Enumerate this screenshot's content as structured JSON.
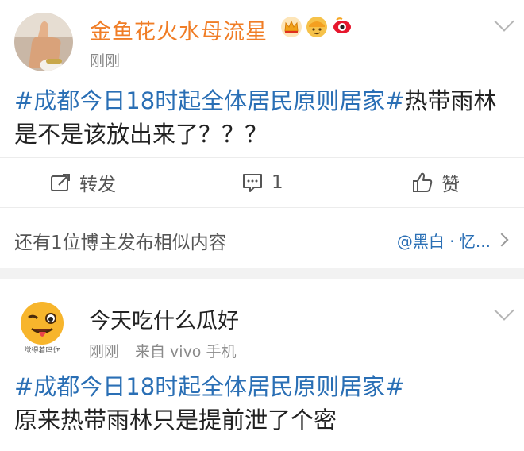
{
  "post1": {
    "username": "金鱼花火水母流星",
    "timestamp": "刚刚",
    "hashtag": "#成都今日18时起全体居民原则居家#",
    "body": "热带雨林是不是该放出来了？？？",
    "actions": {
      "repost_label": "转发",
      "comment_count": "1",
      "like_label": "赞"
    },
    "similar": {
      "text": "还有1位博主发布相似内容",
      "link": "@黑白 · 忆..."
    },
    "badges": [
      "crown-badge-icon",
      "sticker-badge-icon",
      "weibo-eye-badge-icon"
    ]
  },
  "post2": {
    "username": "今天吃什么瓜好",
    "timestamp": "刚刚",
    "source": "来自 vivo 手机",
    "avatar_caption": "觉得着吗你",
    "hashtag": "#成都今日18时起全体居民原则居家#",
    "body": "原来热带雨林只是提前泄了个密"
  },
  "colors": {
    "username_accent": "#f07d26",
    "hashtag": "#2a6fb5",
    "divider": "#f2f2f2"
  }
}
